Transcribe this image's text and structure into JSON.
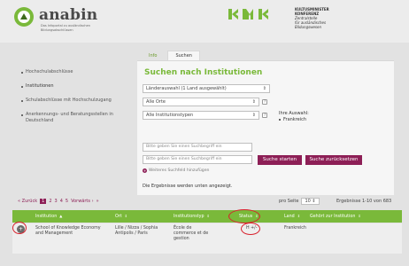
{
  "header": {
    "brand": "anabin",
    "brand_sub": "Das Infoportal zu ausländischen Bildungsabschlüssen",
    "kmk_lines": [
      "KULTUSMINISTER",
      "KONFERENZ",
      "Zentralstelle",
      "für ausländisches",
      "Bildungswesen"
    ],
    "kmk_logo": "KMK"
  },
  "sidebar": {
    "items": [
      {
        "label": "Hochschulabschlüsse",
        "active": false
      },
      {
        "label": "Institutionen",
        "active": true
      },
      {
        "label": "Schulabschlüsse mit Hochschulzugang",
        "active": false
      },
      {
        "label": "Anerkennungs- und Beratungsstellen in Deutschland",
        "active": false
      }
    ]
  },
  "tabs": [
    {
      "label": "Info",
      "active": false
    },
    {
      "label": "Suchen",
      "active": true
    }
  ],
  "main": {
    "title": "Suchen nach Institutionen",
    "country_select": "Länderauswahl (1 Land ausgewählt)",
    "city_select": "Alle Orte",
    "type_select": "Alle Institutionstypen",
    "your_choice_label": "Ihre Auswahl:",
    "your_choice_value": "Frankreich",
    "search_placeholder_1": "Bitte geben Sie einen Suchbegriff ein",
    "search_placeholder_2": "Bitte geben Sie einen Suchbegriff ein",
    "search_button": "Suche starten",
    "reset_button": "Suche zurücksetzen",
    "add_field": "Weiteres Suchfeld hinzufügen",
    "results_note": "Die Ergebnisse werden unten angezeigt."
  },
  "pager": {
    "back": "« Zurück",
    "pages": [
      "1",
      "2",
      "3",
      "4",
      "5"
    ],
    "current": "1",
    "forward": "Vorwärts ›",
    "last": "»",
    "per_page_label": "pro Seite",
    "per_page_value": "10",
    "results_count": "Ergebnisse 1-10 von 683"
  },
  "table": {
    "columns": [
      "Institution",
      "Ort",
      "Institutionstyp",
      "Status",
      "Land",
      "Gehört zur Institution"
    ],
    "row": {
      "institution": "School of Knowledge Economy and Management",
      "ort": "Lille / Nizza / Sophia Antipolis / Paris",
      "typ": "École de commerce et de gestion",
      "status": "H +/-",
      "land": "Frankreich",
      "gehoert": ""
    }
  },
  "colors": {
    "accent_green": "#7ab93a",
    "button_purple": "#8d1f56",
    "annotation_red": "#d8202c"
  }
}
